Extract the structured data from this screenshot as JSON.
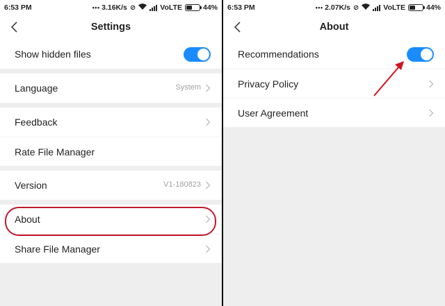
{
  "left": {
    "status": {
      "time": "6:53 PM",
      "speed": "3.16K/s",
      "network": "VoLTE",
      "battery": "44%"
    },
    "title": "Settings",
    "groups": [
      {
        "rows": [
          {
            "label": "Show hidden files",
            "toggle": true
          }
        ]
      },
      {
        "rows": [
          {
            "label": "Language",
            "value": "System"
          }
        ]
      },
      {
        "rows": [
          {
            "label": "Feedback"
          },
          {
            "label": "Rate File Manager"
          }
        ]
      },
      {
        "rows": [
          {
            "label": "Version",
            "value": "V1-180823"
          }
        ]
      },
      {
        "rows": [
          {
            "label": "About"
          },
          {
            "label": "Share File Manager"
          }
        ]
      }
    ],
    "highlight_color": "#c0182a"
  },
  "right": {
    "status": {
      "time": "6:53 PM",
      "speed": "2.07K/s",
      "network": "VoLTE",
      "battery": "44%"
    },
    "title": "About",
    "rows": [
      {
        "label": "Recommendations",
        "toggle": true
      },
      {
        "label": "Privacy Policy"
      },
      {
        "label": "User Agreement"
      }
    ],
    "arrow_color": "#d0141e"
  },
  "colors": {
    "toggle_on": "#1a8cff",
    "background": "#eeeeee"
  },
  "icons": [
    "back-arrow-icon",
    "chevron-right-icon",
    "wifi-icon",
    "signal-icon",
    "battery-icon",
    "alarm-off-icon"
  ]
}
